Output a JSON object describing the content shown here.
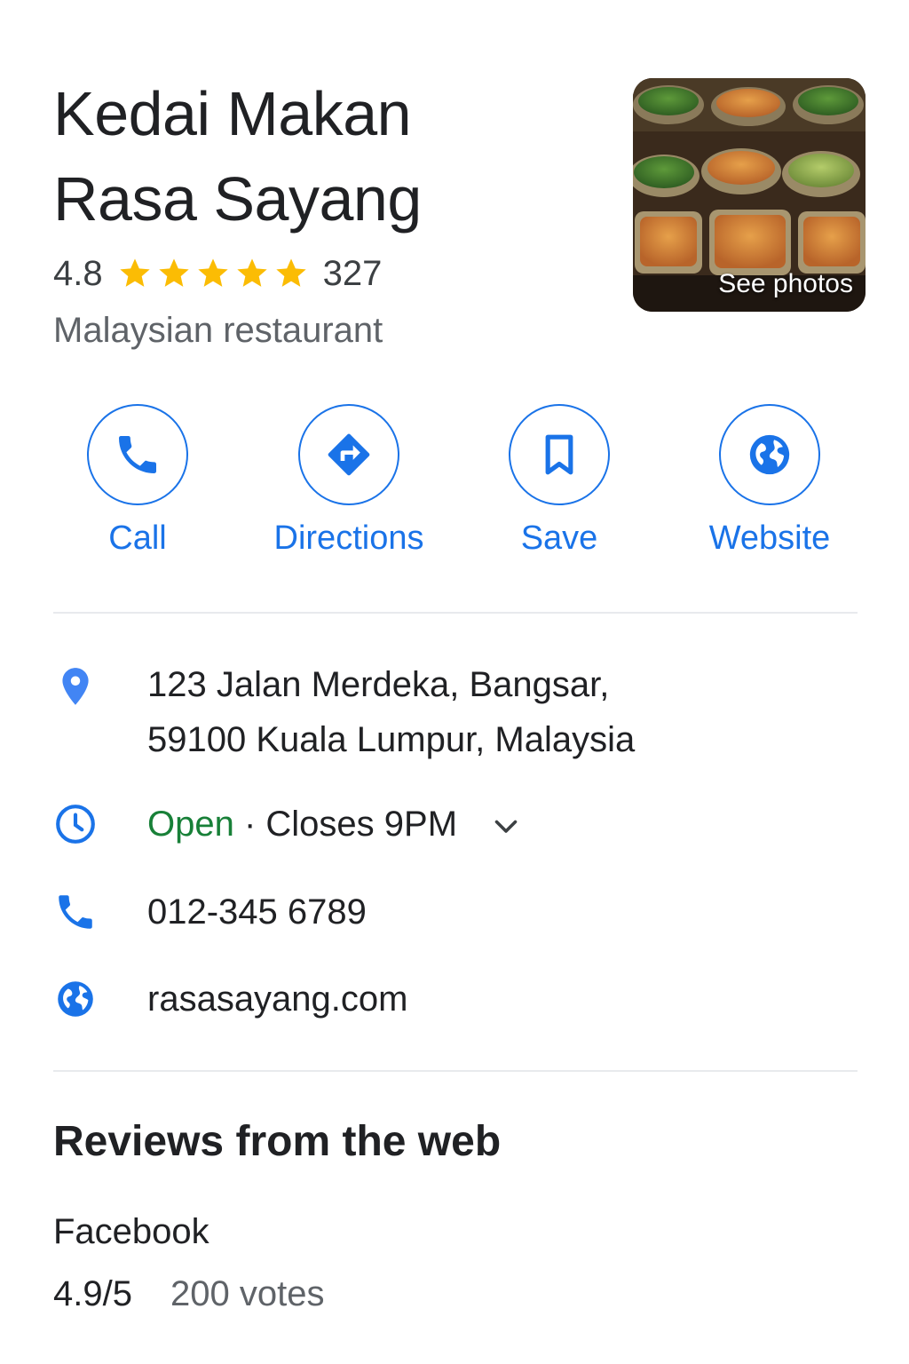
{
  "place": {
    "name_line1": "Kedai Makan",
    "name_line2": "Rasa Sayang",
    "rating": "4.8",
    "stars": 5,
    "review_count": "327",
    "category": "Malaysian restaurant",
    "photo_label": "See photos"
  },
  "actions": [
    {
      "label": "Call",
      "icon": "phone-icon"
    },
    {
      "label": "Directions",
      "icon": "directions-icon"
    },
    {
      "label": "Save",
      "icon": "bookmark-icon"
    },
    {
      "label": "Website",
      "icon": "globe-icon"
    }
  ],
  "info": {
    "address_line1": "123 Jalan Merdeka, Bangsar,",
    "address_line2": "59100 Kuala Lumpur, Malaysia",
    "open_status": "Open",
    "separator": " · ",
    "closes": "Closes 9PM",
    "phone": "012-345 6789",
    "website": "rasasayang.com"
  },
  "reviews": {
    "section_title": "Reviews from the web",
    "source": "Facebook",
    "score": "4.9/5",
    "votes": "200 votes"
  },
  "colors": {
    "accent": "#1a73e8",
    "star": "#fbbc04",
    "open": "#188038",
    "pin": "#4285f4"
  }
}
